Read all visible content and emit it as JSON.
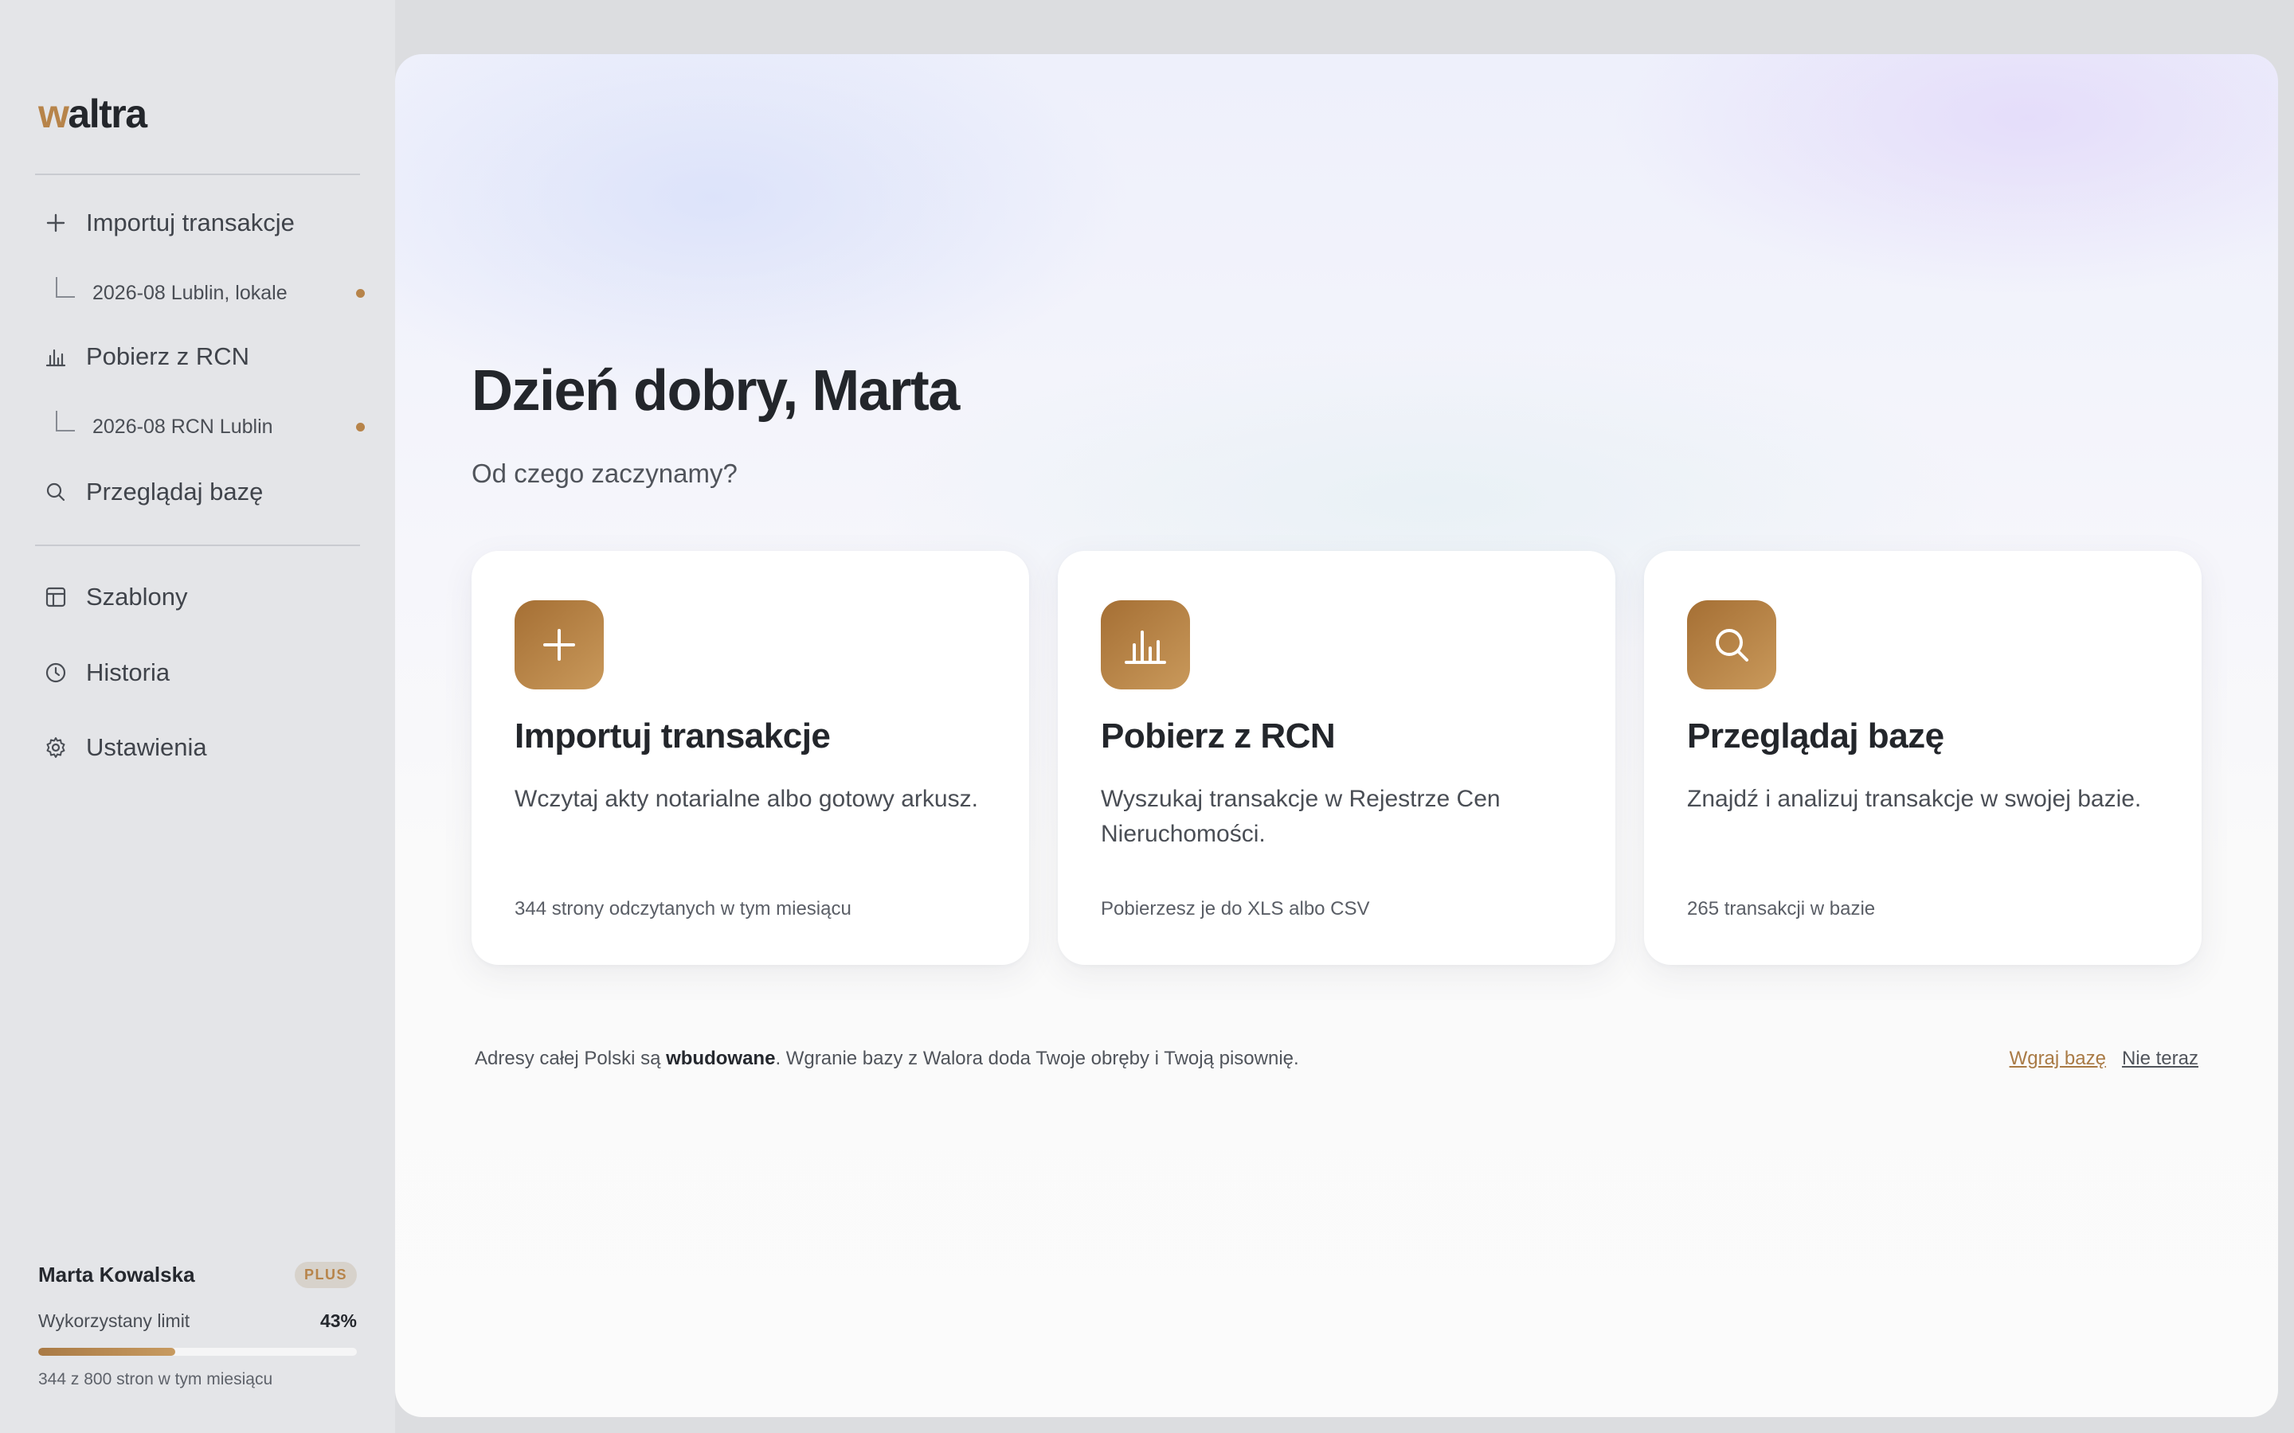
{
  "brand": {
    "logo_first": "w",
    "logo_rest": "altra",
    "accent": "#b7844a"
  },
  "sidebar": {
    "items": [
      {
        "label": "Importuj transakcje",
        "icon": "plus-icon"
      },
      {
        "label": "Pobierz z RCN",
        "icon": "bar-chart-icon"
      },
      {
        "label": "Przeglądaj bazę",
        "icon": "search-icon"
      },
      {
        "label": "Szablony",
        "icon": "template-icon"
      },
      {
        "label": "Historia",
        "icon": "clock-icon"
      },
      {
        "label": "Ustawienia",
        "icon": "gear-icon"
      }
    ],
    "sub_items": [
      {
        "label": "2026-08 Lublin, lokale"
      },
      {
        "label": "2026-08 RCN Lublin"
      }
    ]
  },
  "user": {
    "name": "Marta Kowalska",
    "plan": "PLUS",
    "limit_label": "Wykorzystany limit",
    "limit_percent": "43%",
    "limit_fraction": 0.43,
    "limit_note": "344 z 800 stron w tym miesiącu"
  },
  "main": {
    "greeting": "Dzień dobry, Marta",
    "subtitle": "Od czego zaczynamy?",
    "cards": [
      {
        "title": "Importuj transakcje",
        "description": "Wczytaj akty notarialne albo gotowy arkusz.",
        "footer": "344 strony odczytanych w tym miesiącu",
        "icon": "plus-icon"
      },
      {
        "title": "Pobierz z RCN",
        "description": "Wyszukaj transakcje w Rejestrze Cen Nieruchomości.",
        "footer": "Pobierzesz je do XLS albo CSV",
        "icon": "bar-chart-icon"
      },
      {
        "title": "Przeglądaj bazę",
        "description": "Znajdź i analizuj transakcje w swojej bazie.",
        "footer": "265 transakcji w bazie",
        "icon": "search-icon"
      }
    ],
    "notice": {
      "before": "Adresy całej Polski są ",
      "bold": "wbudowane",
      "after": ". Wgranie bazy z Walora doda Twoje obręby i Twoją pisownię."
    },
    "actions": {
      "primary": "Wgraj bazę",
      "secondary": "Nie teraz"
    }
  }
}
